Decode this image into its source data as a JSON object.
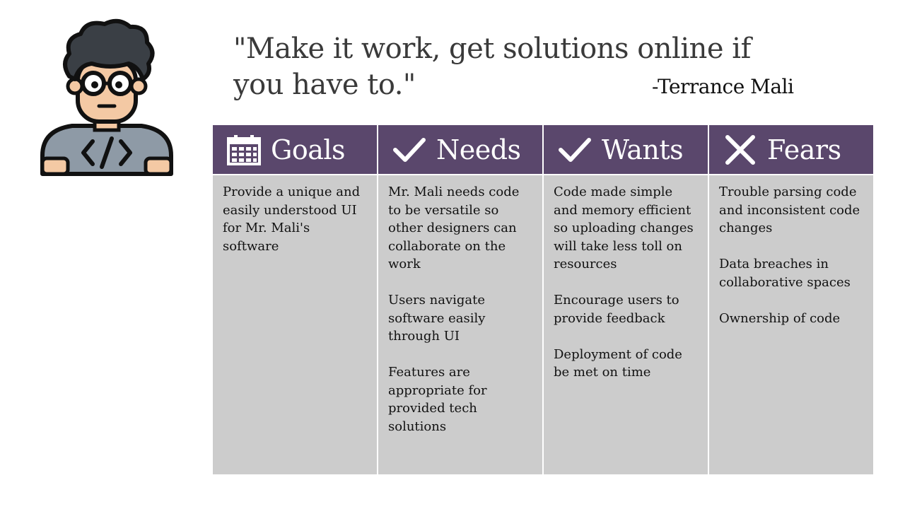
{
  "avatar": {
    "icon": "developer-avatar-icon"
  },
  "quote": {
    "text": "\"Make it work, get solutions online if you have to.\"",
    "author": "-Terrance Mali"
  },
  "columns": [
    {
      "title": "Goals",
      "icon": "calendar-icon",
      "items": [
        "Provide a unique and easily understood UI for Mr. Mali's software"
      ]
    },
    {
      "title": "Needs",
      "icon": "check-icon",
      "items": [
        "Mr. Mali needs code to be versatile so other designers can collaborate on the work",
        "Users navigate software easily through UI",
        "Features are appropriate for provided tech solutions"
      ]
    },
    {
      "title": "Wants",
      "icon": "check-icon",
      "items": [
        "Code made simple and memory efficient so uploading changes will take less toll on resources",
        "Encourage users to provide feedback",
        "Deployment of code be met on time"
      ]
    },
    {
      "title": "Fears",
      "icon": "x-icon",
      "items": [
        "Trouble parsing code and inconsistent code changes",
        "Data breaches in collaborative spaces",
        "Ownership of code"
      ]
    }
  ],
  "colors": {
    "header": "#5a476c",
    "cell": "#cccccc",
    "quote_text": "#3a3a3a"
  }
}
